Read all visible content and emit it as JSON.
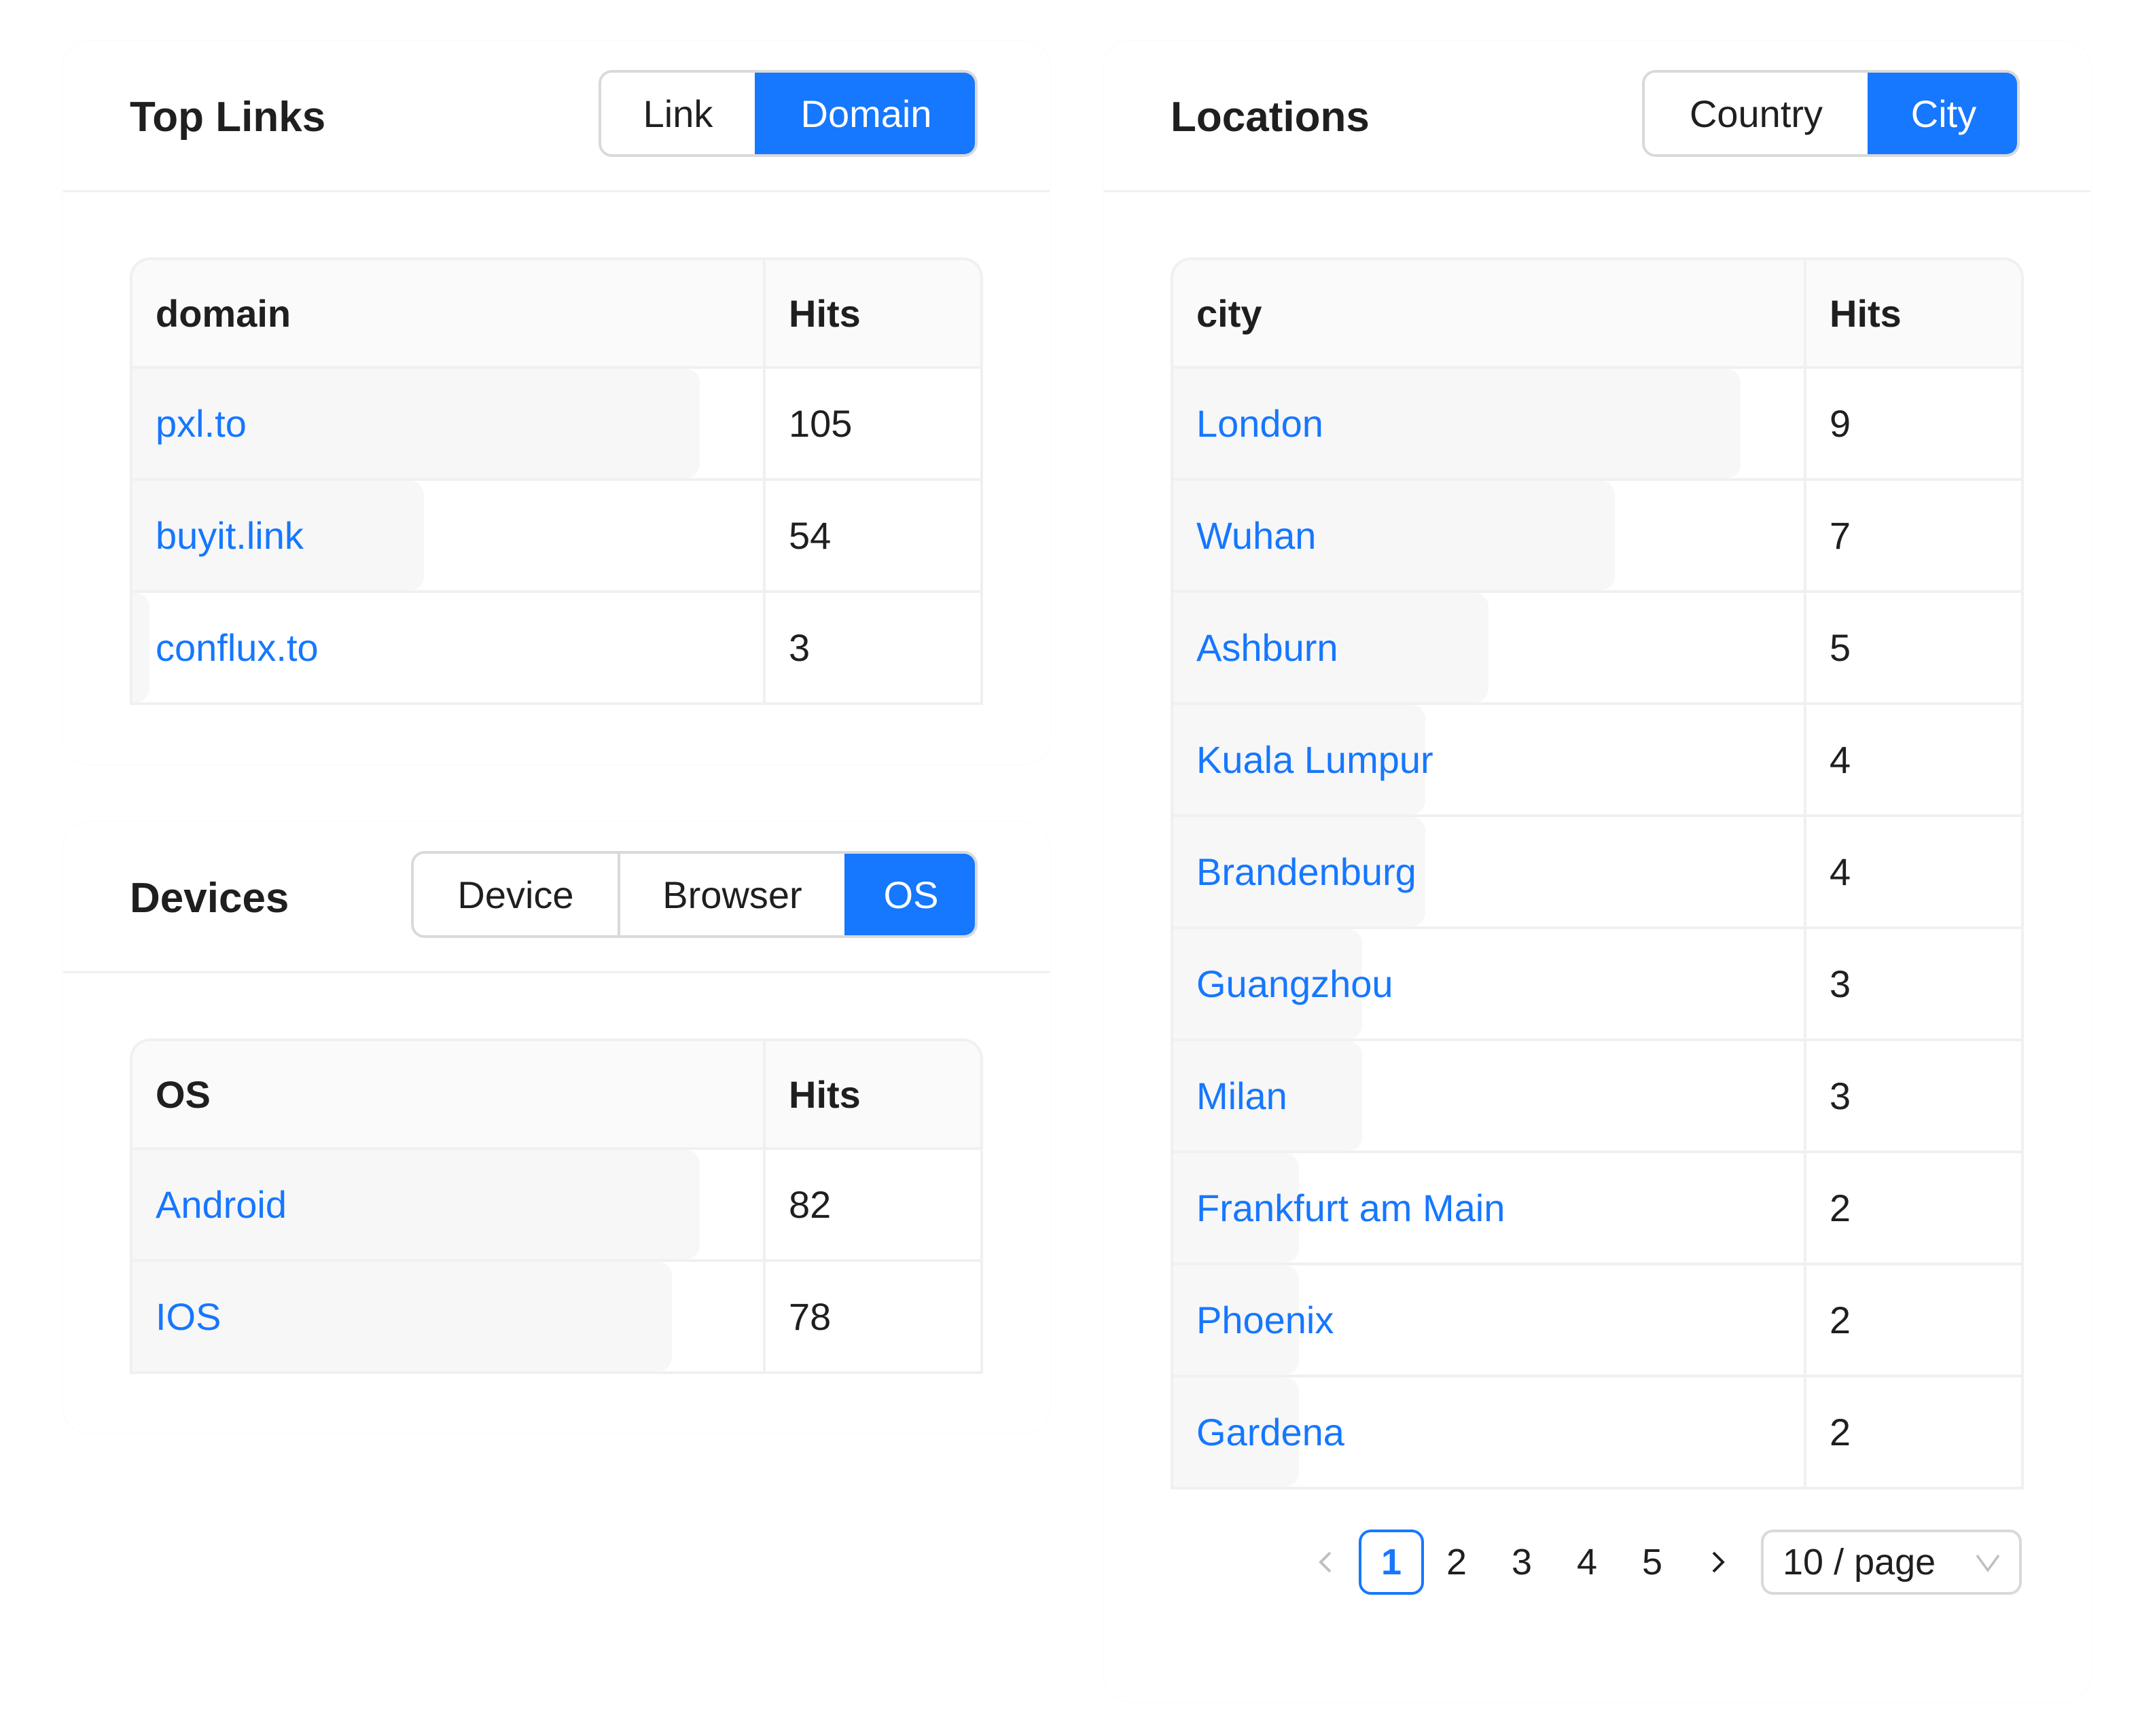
{
  "accent_color": "#1677ff",
  "top_links": {
    "title": "Top Links",
    "segments": [
      {
        "label": "Link",
        "active": false
      },
      {
        "label": "Domain",
        "active": true
      }
    ],
    "table": {
      "columns": [
        "domain",
        "Hits"
      ],
      "rows": [
        {
          "name": "pxl.to",
          "hits": "105",
          "share": 1.0
        },
        {
          "name": "buyit.link",
          "hits": "54",
          "share": 0.514
        },
        {
          "name": "conflux.to",
          "hits": "3",
          "share": 0.029
        }
      ]
    }
  },
  "devices": {
    "title": "Devices",
    "segments": [
      {
        "label": "Device",
        "active": false
      },
      {
        "label": "Browser",
        "active": false
      },
      {
        "label": "OS",
        "active": true
      }
    ],
    "table": {
      "columns": [
        "OS",
        "Hits"
      ],
      "rows": [
        {
          "name": "Android",
          "hits": "82",
          "share": 1.0
        },
        {
          "name": "IOS",
          "hits": "78",
          "share": 0.951
        }
      ]
    }
  },
  "locations": {
    "title": "Locations",
    "segments": [
      {
        "label": "Country",
        "active": false
      },
      {
        "label": "City",
        "active": true
      }
    ],
    "table": {
      "columns": [
        "city",
        "Hits"
      ],
      "rows": [
        {
          "name": "London",
          "hits": "9",
          "share": 1.0
        },
        {
          "name": "Wuhan",
          "hits": "7",
          "share": 0.778
        },
        {
          "name": "Ashburn",
          "hits": "5",
          "share": 0.556
        },
        {
          "name": "Kuala Lumpur",
          "hits": "4",
          "share": 0.444
        },
        {
          "name": "Brandenburg",
          "hits": "4",
          "share": 0.444
        },
        {
          "name": "Guangzhou",
          "hits": "3",
          "share": 0.333
        },
        {
          "name": "Milan",
          "hits": "3",
          "share": 0.333
        },
        {
          "name": "Frankfurt am Main",
          "hits": "2",
          "share": 0.222
        },
        {
          "name": "Phoenix",
          "hits": "2",
          "share": 0.222
        },
        {
          "name": "Gardena",
          "hits": "2",
          "share": 0.222
        }
      ]
    },
    "pagination": {
      "pages": [
        "1",
        "2",
        "3",
        "4",
        "5"
      ],
      "current": "1",
      "prev_icon": "chevron-left-icon",
      "next_icon": "chevron-right-icon",
      "page_size": "10 / page"
    }
  }
}
